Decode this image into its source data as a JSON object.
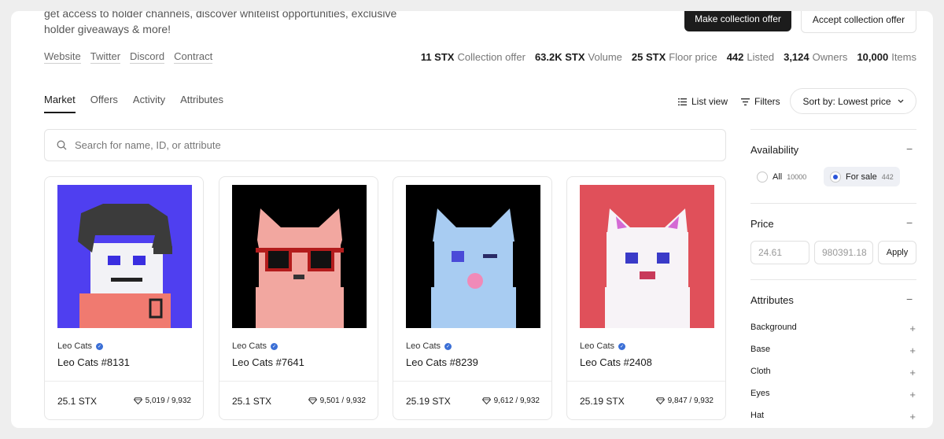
{
  "header": {
    "description": "get access to holder channels, discover whitelist opportunities, exclusive holder giveaways & more!",
    "make_offer_label": "Make collection offer",
    "accept_offer_label": "Accept collection offer"
  },
  "links": [
    "Website",
    "Twitter",
    "Discord",
    "Contract"
  ],
  "stats": [
    {
      "value": "11 STX",
      "label": "Collection offer"
    },
    {
      "value": "63.2K STX",
      "label": "Volume"
    },
    {
      "value": "25 STX",
      "label": "Floor price"
    },
    {
      "value": "442",
      "label": "Listed"
    },
    {
      "value": "3,124",
      "label": "Owners"
    },
    {
      "value": "10,000",
      "label": "Items"
    }
  ],
  "tabs": [
    "Market",
    "Offers",
    "Activity",
    "Attributes"
  ],
  "active_tab": "Market",
  "toolbar": {
    "list_view_label": "List view",
    "filters_label": "Filters",
    "sort_label": "Sort by: Lowest price"
  },
  "search": {
    "placeholder": "Search for name, ID, or attribute"
  },
  "cards": [
    {
      "collection": "Leo Cats",
      "name": "Leo Cats #8131",
      "price": "25.1 STX",
      "rank": "5,019 / 9,932",
      "bg": "#4f3ff0",
      "fur": "#f2f2f6"
    },
    {
      "collection": "Leo Cats",
      "name": "Leo Cats #7641",
      "price": "25.1 STX",
      "rank": "9,501 / 9,932",
      "bg": "#000000",
      "fur": "#f2a7a0"
    },
    {
      "collection": "Leo Cats",
      "name": "Leo Cats #8239",
      "price": "25.19 STX",
      "rank": "9,612 / 9,932",
      "bg": "#000000",
      "fur": "#a8ccf2"
    },
    {
      "collection": "Leo Cats",
      "name": "Leo Cats #2408",
      "price": "25.19 STX",
      "rank": "9,847 / 9,932",
      "bg": "#e0505a",
      "fur": "#f7f3f7"
    }
  ],
  "sidebar": {
    "availability": {
      "title": "Availability",
      "options": [
        {
          "label": "All",
          "count": "10000",
          "selected": false
        },
        {
          "label": "For sale",
          "count": "442",
          "selected": true
        }
      ]
    },
    "price": {
      "title": "Price",
      "min_placeholder": "24.61",
      "max_placeholder": "980391.18",
      "apply_label": "Apply"
    },
    "attributes": {
      "title": "Attributes",
      "items": [
        "Background",
        "Base",
        "Cloth",
        "Eyes",
        "Hat"
      ]
    }
  },
  "colors": {
    "accent": "#2b55d9",
    "dark_button": "#1c1c1c",
    "verified": "#3b6fd6"
  }
}
